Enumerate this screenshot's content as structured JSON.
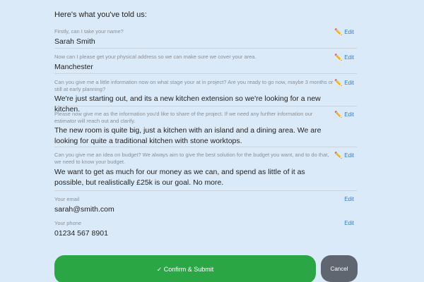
{
  "intro": "Here's what you've told us:",
  "edit_label": "Edit",
  "edit_icon": "pencil-icon",
  "items": [
    {
      "question": "Firstly, can I take your name?",
      "answer": "Sarah Smith"
    },
    {
      "question": "Now can I please get your physical address so we can make sure we cover your area.",
      "answer": "Manchester"
    },
    {
      "question": "Can you give me a little information now on what stage your at in project? Are you ready to go now, maybe 3 months or still at early planning?",
      "answer": "We're just starting out, and its a new kitchen extension so we're looking for a new kitchen."
    },
    {
      "question": "Please now give me as the information you'd like to share of the project. If we need any further information our estimator will reach out and clarify.",
      "answer": "The new room is quite big, just a kitchen with an island and a dining area. We are looking for quite a traditional kitchen with stone worktops."
    },
    {
      "question": "Can you give me an idea on budget? We always aim to give the best solution for the budget you want, and to do that, we need to know your budget.",
      "answer": "We want to get as much for our money as we can, and spend as little of it as possible, but realistically £25k is our goal. No more."
    }
  ],
  "contact": {
    "email_label": "Your email",
    "email": "sarah@smith.com",
    "phone_label": "Your phone",
    "phone": "01234 567 8901"
  },
  "buttons": {
    "confirm": "✓ Confirm & Submit",
    "cancel": "Cancel"
  },
  "colors": {
    "background": "#dbeaf8",
    "confirm": "#2aa645",
    "cancel": "#5f6670",
    "link": "#2f7fd0"
  }
}
